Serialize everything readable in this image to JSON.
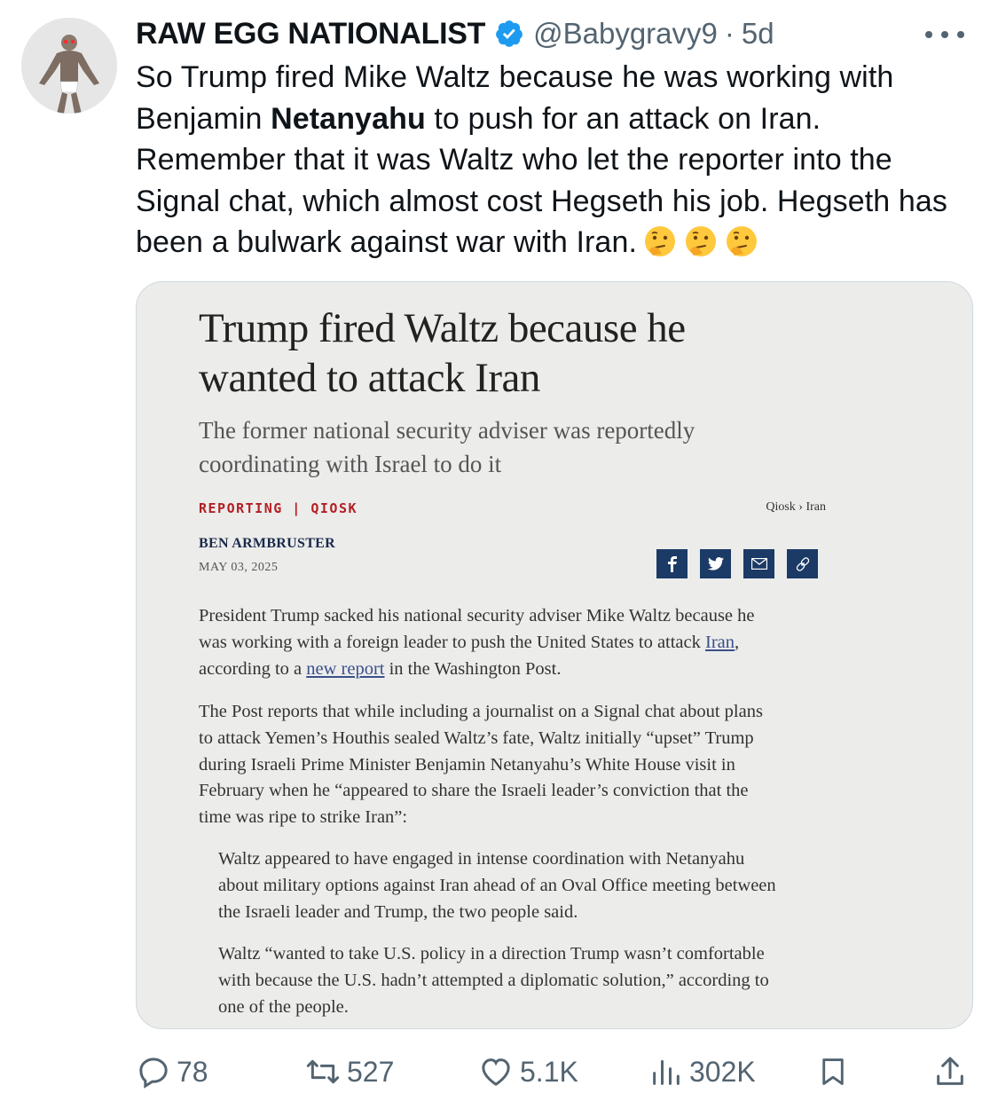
{
  "author": {
    "display_name": "RAW EGG NATIONALIST",
    "handle": "@Babygravy9",
    "separator": "·",
    "time": "5d"
  },
  "tweet": {
    "text_part1": "So Trump fired Mike Waltz because he was working with Benjamin ",
    "text_bold": "Netanyahu",
    "text_part2": " to push for an attack on Iran. Remember that it was Waltz who let the reporter into the Signal chat, which almost cost Hegseth his job. Hegseth has been a bulwark against war with Iran.",
    "emojis": [
      "thinking-face",
      "thinking-face",
      "thinking-face"
    ]
  },
  "article": {
    "title_line1": "Trump fired Waltz because he",
    "title_line2": "wanted to attack Iran",
    "subtitle_line1": "The former national security adviser was reportedly",
    "subtitle_line2": "coordinating with Israel to do it",
    "kicker": "REPORTING | QIOSK",
    "breadcrumb": "Qiosk › Iran",
    "author": "BEN ARMBRUSTER",
    "date": "MAY 03, 2025",
    "share_icons": [
      "facebook-icon",
      "twitter-icon",
      "email-icon",
      "link-icon"
    ],
    "p1_line1": "President Trump sacked his national security adviser Mike Waltz because he",
    "p1_line2a": "was working with a foreign leader to push the United States to attack ",
    "p1_line2_link": "Iran",
    "p1_line2b": ",",
    "p1_line3a": "according to a ",
    "p1_line3_link": "new report",
    "p1_line3b": " in the Washington Post.",
    "p2_lines": [
      "The Post reports that while including a journalist on a Signal chat about plans",
      "to attack Yemen’s Houthis sealed Waltz’s fate, Waltz initially “upset” Trump",
      "during Israeli Prime Minister Benjamin Netanyahu’s White House visit in",
      "February when he “appeared to share the Israeli leader’s conviction that the",
      "time was ripe to strike Iran”:"
    ],
    "q1_lines": [
      "Waltz appeared to have engaged in intense coordination with Netanyahu",
      "about military options against Iran ahead of an Oval Office meeting between",
      "the Israeli leader and Trump, the two people said."
    ],
    "q2_lines": [
      "Waltz “wanted to take U.S. policy in a direction Trump wasn’t comfortable",
      "with because the U.S. hadn’t attempted a diplomatic solution,” according to",
      "one of the people."
    ]
  },
  "actions": {
    "replies": "78",
    "reposts": "527",
    "likes": "5.1K",
    "views": "302K"
  },
  "colors": {
    "accent_blue": "#1d9bf0",
    "muted": "#536471",
    "article_red": "#b21f24",
    "article_navy": "#1b3a66"
  }
}
